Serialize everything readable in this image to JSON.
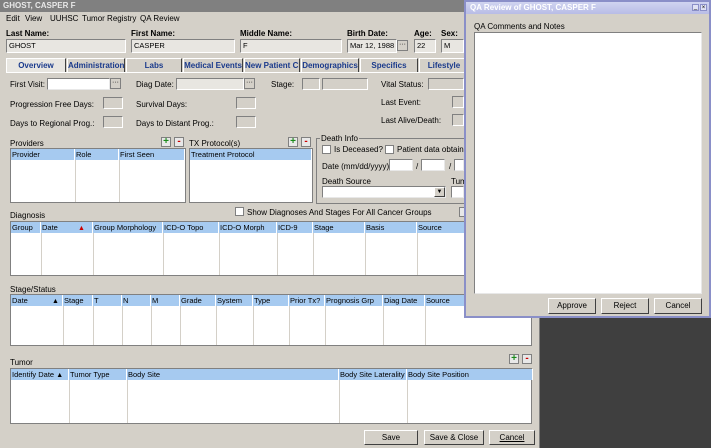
{
  "window": {
    "title": "GHOST, CASPER F"
  },
  "menu": [
    "Edit",
    "View",
    "UUHSC",
    "Tumor Registry",
    "QA Review"
  ],
  "patient": {
    "last_name_label": "Last Name:",
    "last_name": "GHOST",
    "first_name_label": "First Name:",
    "first_name": "CASPER",
    "middle_name_label": "Middle Name:",
    "middle_name": "F",
    "birth_date_label": "Birth Date:",
    "birth_date": "Mar 12, 1988",
    "age_label": "Age:",
    "age": "22",
    "sex_label": "Sex:",
    "sex": "M"
  },
  "tabs": [
    "Overview",
    "Administration",
    "Labs",
    "Medical Events",
    "New Patient Ch",
    "Demographics",
    "Specifics",
    "Lifestyle"
  ],
  "overview": {
    "first_visit": "First Visit:",
    "diag_date": "Diag Date:",
    "stage": "Stage:",
    "vital_status": "Vital Status:",
    "progression_free": "Progression Free Days:",
    "survival_days": "Survival Days:",
    "last_event": "Last Event:",
    "days_regional": "Days to Regional Prog.:",
    "days_distant": "Days to Distant Prog.:",
    "last_alive": "Last Alive/Death:"
  },
  "providers": {
    "title": "Providers",
    "columns": [
      "Provider",
      "Role",
      "First Seen"
    ]
  },
  "tx": {
    "title": "TX Protocol(s)",
    "columns": [
      "Treatment Protocol"
    ]
  },
  "death": {
    "title": "Death Info",
    "is_deceased": "Is Deceased?",
    "patient_data": "Patient data obtained",
    "date": "Date (mm/dd/yyyy)",
    "sep1": "/",
    "sep2": "/",
    "source": "Death Source",
    "tumor": "Tum"
  },
  "diagnosis": {
    "title": "Diagnosis",
    "show_all": "Show Diagnoses And Stages For All Cancer Groups",
    "columns": [
      "Group",
      "Date",
      "Group Morphology",
      "ICD-O Topo",
      "ICD-O Morph",
      "ICD-9",
      "Stage",
      "Basis",
      "Source"
    ]
  },
  "stage_status": {
    "title": "Stage/Status",
    "columns": [
      "Date",
      "Stage",
      "T",
      "N",
      "M",
      "Grade",
      "System",
      "Type",
      "Prior Tx?",
      "Prognosis Grp",
      "Diag Date",
      "Source"
    ]
  },
  "tumor": {
    "title": "Tumor",
    "columns": [
      "Identify Date",
      "Tumor Type",
      "Body Site",
      "Body Site Laterality",
      "Body Site Position"
    ]
  },
  "buttons": {
    "save": "Save",
    "save_close": "Save & Close",
    "cancel": "Cancel"
  },
  "qa": {
    "title": "QA Review of GHOST, CASPER F",
    "comments_label": "QA Comments and Notes",
    "approve": "Approve",
    "reject": "Reject",
    "cancel": "Cancel"
  }
}
